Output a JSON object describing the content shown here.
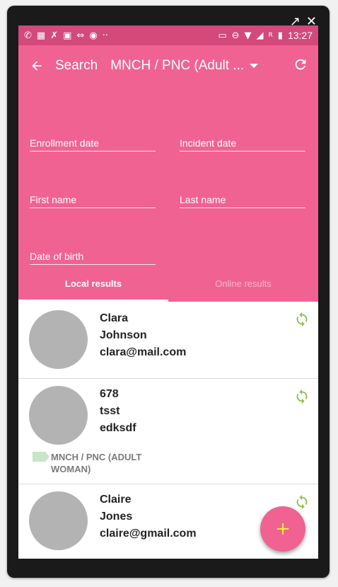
{
  "frame_controls": {
    "popout_icon": "popout-icon",
    "close_icon": "close-icon"
  },
  "status_bar": {
    "time": "13:27",
    "signal_label": "R"
  },
  "toolbar": {
    "title": "Search",
    "program": "MNCH / PNC (Adult ..."
  },
  "fields": [
    {
      "label": "Enrollment date"
    },
    {
      "label": "Incident date"
    },
    {
      "label": "First name"
    },
    {
      "label": "Last name"
    },
    {
      "label": "Date of birth"
    }
  ],
  "tabs": [
    {
      "label": "Local results",
      "active": true
    },
    {
      "label": "Online results",
      "active": false
    }
  ],
  "results": [
    {
      "lines": [
        "Clara",
        "Johnson",
        "clara@mail.com"
      ]
    },
    {
      "lines": [
        "678",
        "tsst",
        "edksdf"
      ],
      "program": "MNCH / PNC (ADULT WOMAN)"
    },
    {
      "lines": [
        "Claire",
        "Jones",
        "claire@gmail.com"
      ]
    }
  ],
  "fab": {
    "label": "+"
  },
  "colors": {
    "accent": "#f06292",
    "status_bar": "#d2497a",
    "sync": "#8bc34a",
    "fab_icon": "#ffeb3b"
  }
}
